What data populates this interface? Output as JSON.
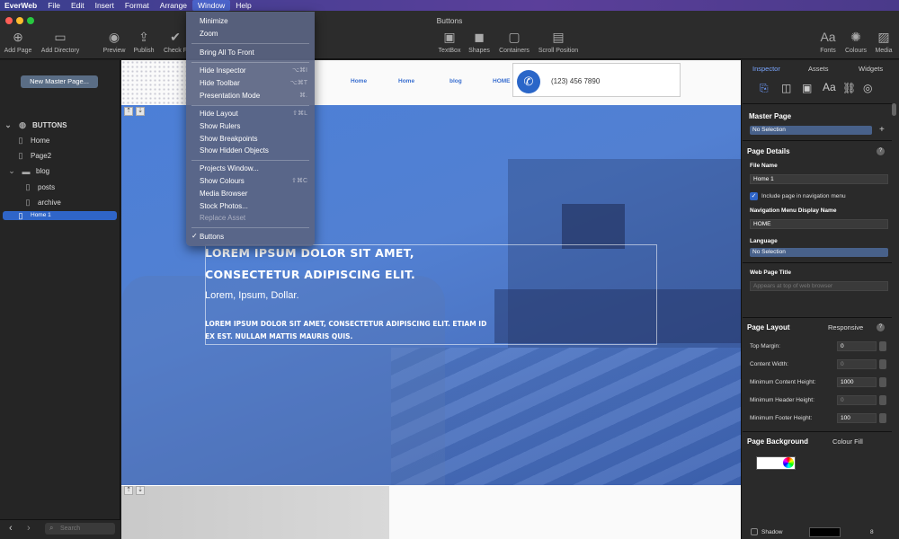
{
  "menubar": {
    "app": "EverWeb",
    "items": [
      "File",
      "Edit",
      "Insert",
      "Format",
      "Arrange",
      "Window",
      "Help"
    ]
  },
  "window": {
    "title": "Buttons"
  },
  "toolbar": {
    "left": [
      {
        "label": "Add Page",
        "icon": "add-page-icon"
      },
      {
        "label": "Add Directory",
        "icon": "add-directory-icon"
      },
      {
        "label": "Preview",
        "icon": "eye-icon"
      },
      {
        "label": "Publish",
        "icon": "publish-icon"
      },
      {
        "label": "Check F",
        "icon": "shield-check-icon"
      }
    ],
    "center": [
      {
        "label": "TextBox",
        "icon": "textbox-icon"
      },
      {
        "label": "Shapes",
        "icon": "shapes-icon"
      },
      {
        "label": "Containers",
        "icon": "containers-icon"
      },
      {
        "label": "Scroll Position",
        "icon": "scroll-icon"
      }
    ],
    "right": [
      {
        "label": "Fonts",
        "icon": "fonts-icon",
        "glyph": "Aa"
      },
      {
        "label": "Colours",
        "icon": "palette-icon"
      },
      {
        "label": "Media",
        "icon": "media-icon"
      }
    ]
  },
  "sidebar": {
    "new_master_label": "New Master Page...",
    "site_name": "BUTTONS",
    "items": [
      {
        "label": "Home"
      },
      {
        "label": "Page2"
      },
      {
        "label": "blog"
      },
      {
        "label": "posts"
      },
      {
        "label": "archive"
      },
      {
        "label": "Home 1"
      }
    ],
    "search_placeholder": "Search"
  },
  "window_menu": {
    "items": [
      "Minimize",
      "Zoom",
      "Bring All To Front",
      "Hide Inspector",
      "Hide Toolbar",
      "Presentation Mode",
      "Hide Layout",
      "Show Rulers",
      "Show Breakpoints",
      "Show Hidden Objects",
      "Projects Window...",
      "Show Colours",
      "Media Browser",
      "Stock Photos...",
      "Replace Asset",
      "Buttons"
    ],
    "shortcuts": {
      "hide_inspector": "⌥⌘I",
      "hide_toolbar": "⌥⌘T",
      "presentation": "⌘.",
      "hide_layout": "⇧⌘L",
      "show_colours": "⇧⌘C"
    },
    "checkmark": "✓"
  },
  "page": {
    "nav": [
      "Home",
      "Home",
      "blog",
      "HOME"
    ],
    "phone": "(123) 456 7890",
    "headline1": "LOREM IPSUM DOLOR SIT AMET,",
    "headline2": "CONSECTETUR ADIPISCING ELIT.",
    "subline": "Lorem, Ipsum, Dollar.",
    "para1": "LOREM IPSUM DOLOR SIT AMET, CONSECTETUR ADIPISCING ELIT. ETIAM ID",
    "para2": "EX EST. NULLAM MATTIS MAURIS QUIS."
  },
  "inspector": {
    "tabs": [
      "Inspector",
      "Assets",
      "Widgets"
    ],
    "master_page": "Master Page",
    "master_select": "No Selection",
    "page_details": "Page Details",
    "file_name_label": "File Name",
    "file_name": "Home 1",
    "include_nav": "Include page in navigation menu",
    "nav_display_label": "Navigation Menu Display Name",
    "nav_display": "HOME",
    "language_label": "Language",
    "language": "No Selection",
    "web_title_label": "Web Page Title",
    "web_title_placeholder": "Appears at top of web browser",
    "page_layout": "Page Layout",
    "layout_mode": "Responsive",
    "top_margin_label": "Top Margin:",
    "top_margin": "0",
    "content_width_label": "Content Width:",
    "content_width": "0",
    "min_content_label": "Minimum Content Height:",
    "min_content": "1000",
    "min_header_label": "Minimum Header Height:",
    "min_header": "0",
    "min_footer_label": "Minimum Footer Height:",
    "min_footer": "100",
    "page_background": "Page Background",
    "bg_mode": "Colour Fill",
    "shadow_label": "Shadow",
    "shadow_value": "8"
  },
  "colors": {
    "accent": "#2f65c8",
    "hero": "#4c7fd7",
    "menubar": "#3a3f8f"
  }
}
